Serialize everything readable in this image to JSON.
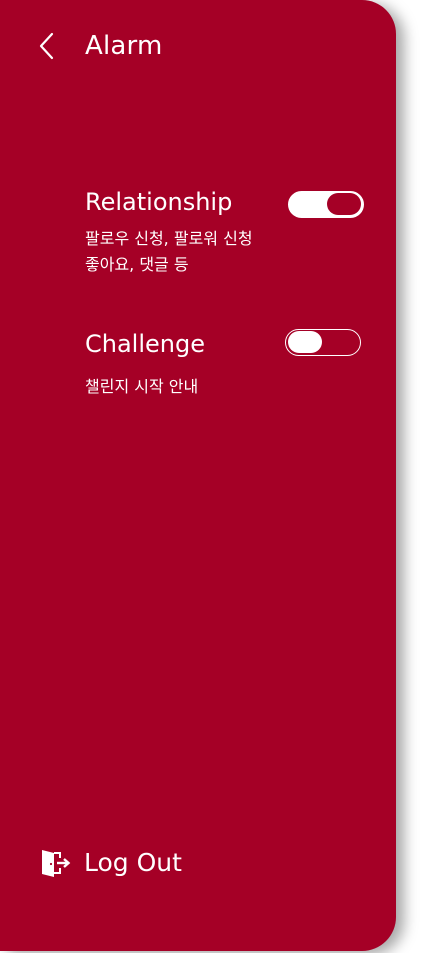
{
  "header": {
    "back_icon": "chevron-left-icon",
    "title": "Alarm"
  },
  "settings": [
    {
      "title": "Relationship",
      "description_lines": [
        "팔로우 신청, 팔로워 신청",
        "좋아요, 댓글 등"
      ],
      "enabled": true
    },
    {
      "title": "Challenge",
      "description_lines": [
        "챌린지 시작 안내"
      ],
      "enabled": false
    }
  ],
  "footer": {
    "logout_icon": "door-exit-icon",
    "logout_label": "Log Out"
  },
  "colors": {
    "panel_background": "#a50026",
    "text": "#ffffff",
    "page_background": "#ffffff"
  }
}
